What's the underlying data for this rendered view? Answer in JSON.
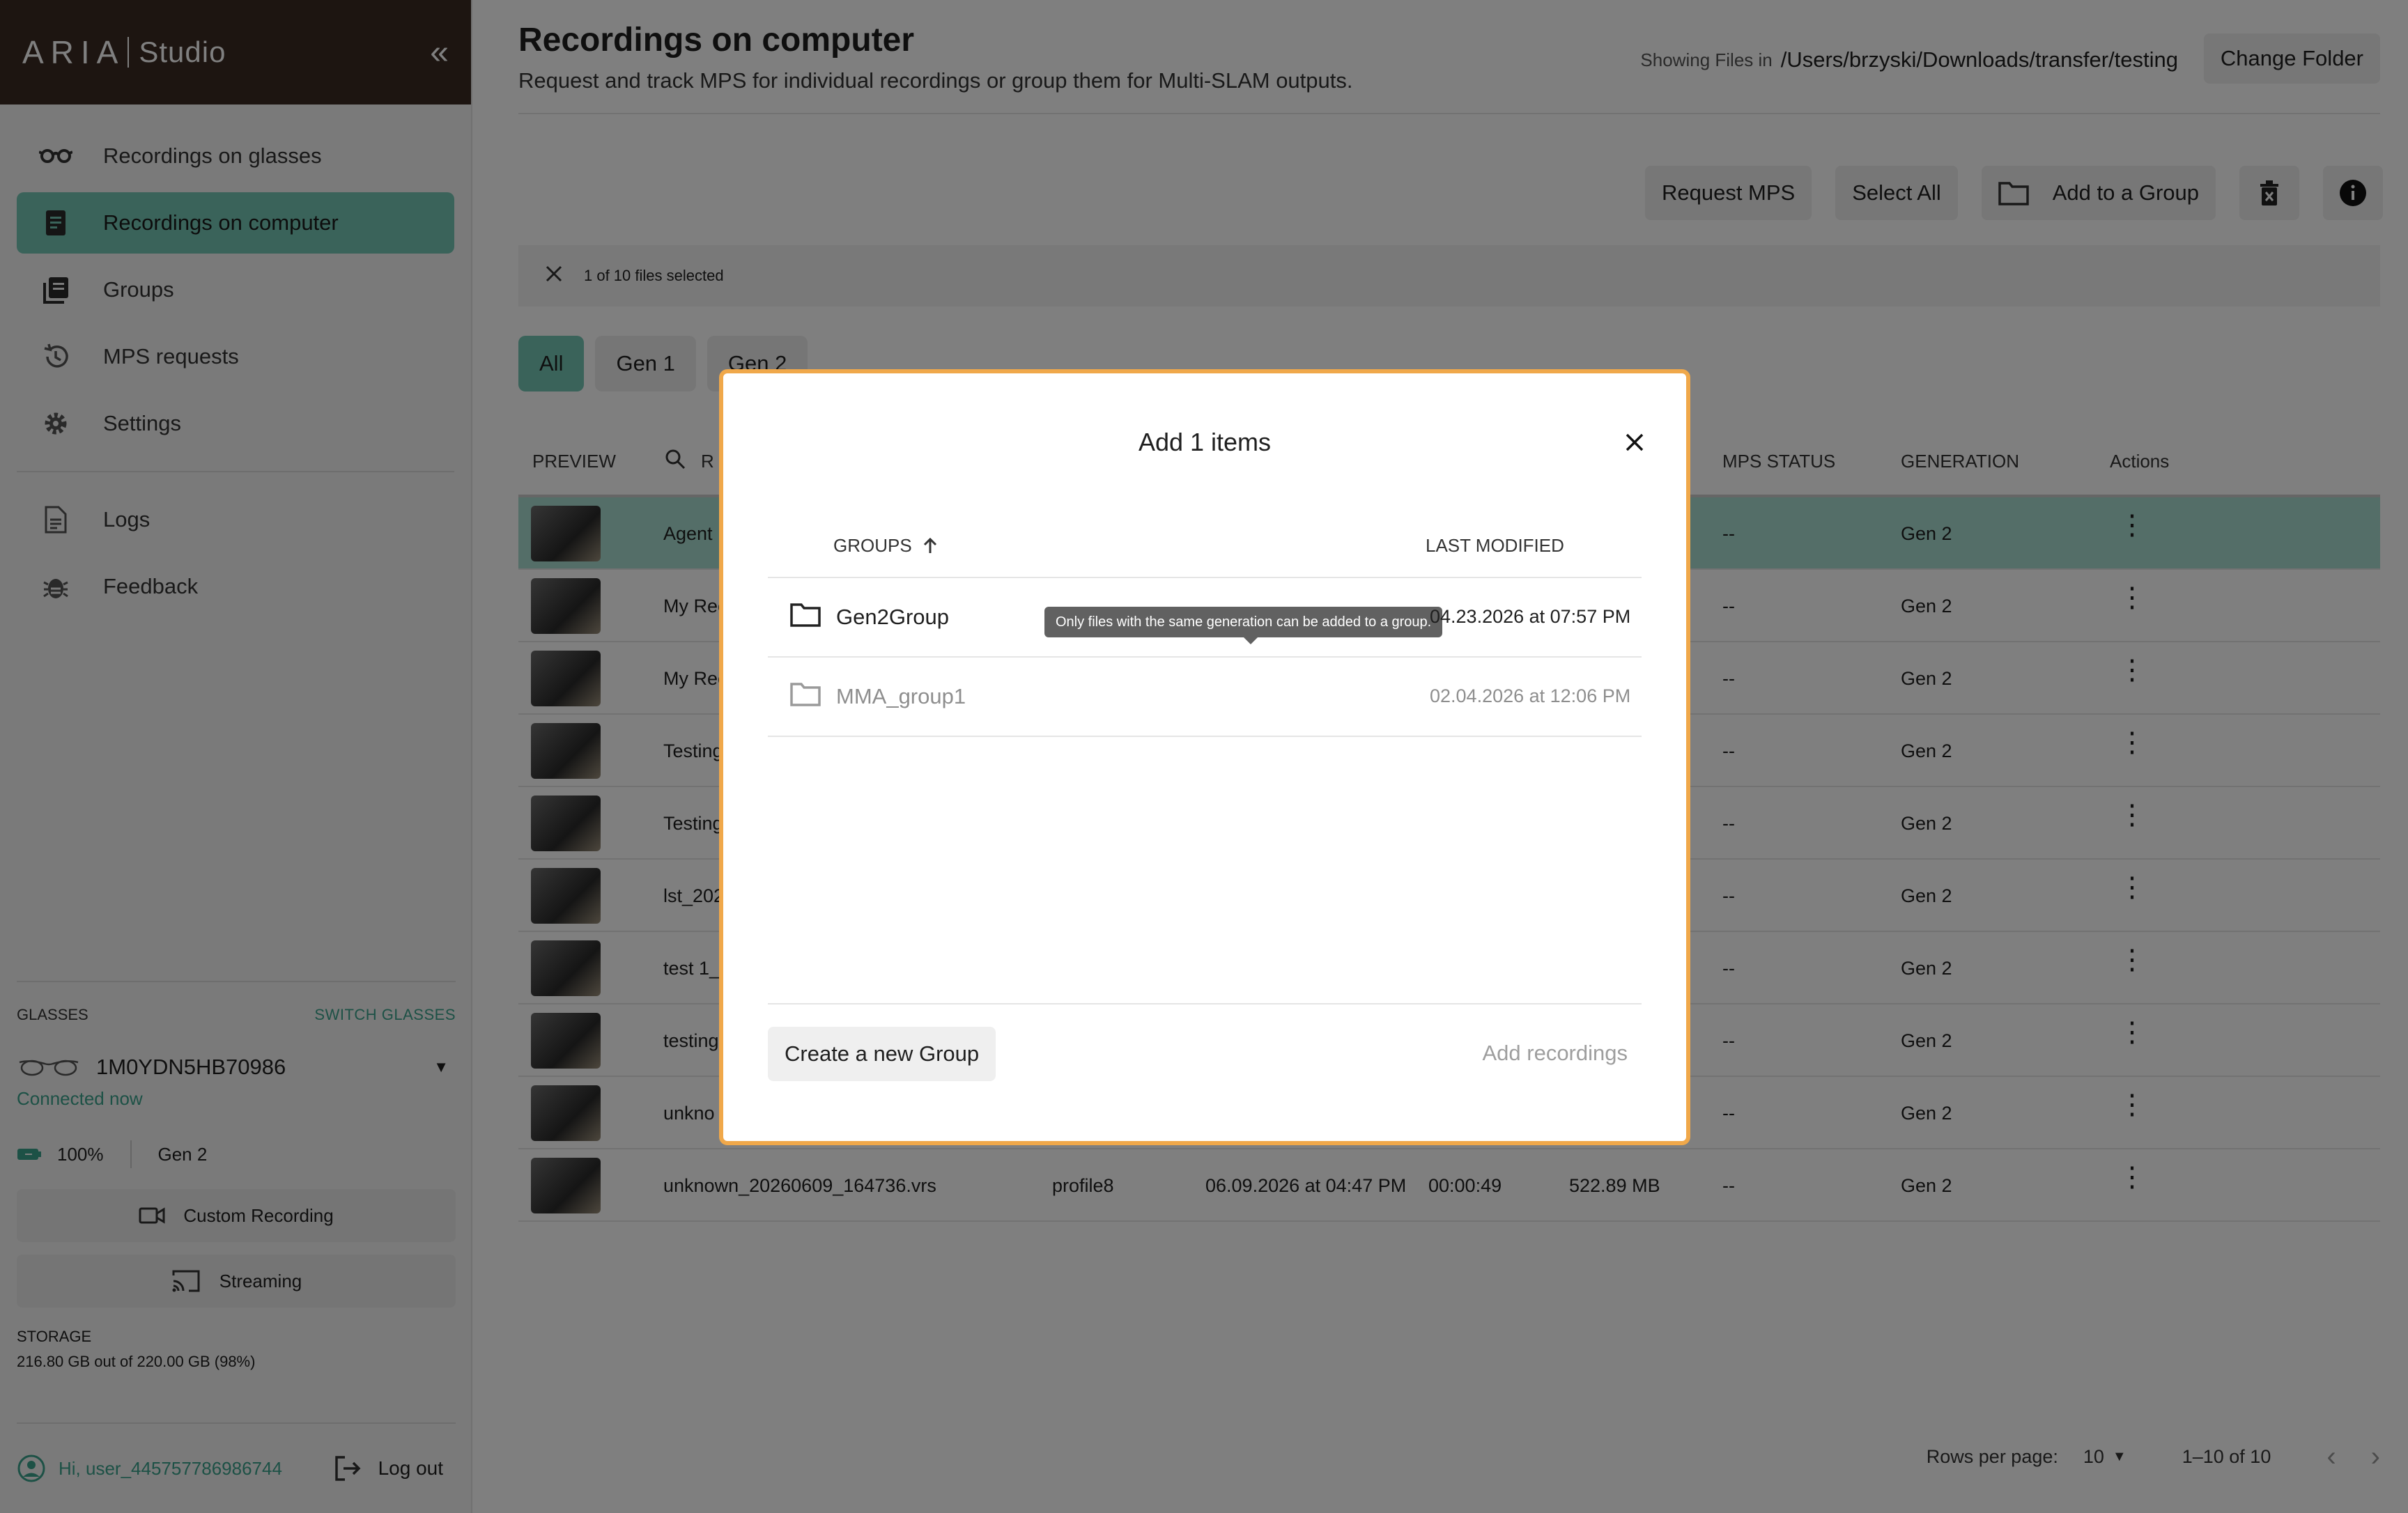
{
  "brand": {
    "name": "ARIA",
    "product": "Studio"
  },
  "sidebar": {
    "items": [
      {
        "label": "Recordings on glasses",
        "icon": "glasses-icon"
      },
      {
        "label": "Recordings on computer",
        "icon": "document-icon",
        "active": true
      },
      {
        "label": "Groups",
        "icon": "groups-icon"
      },
      {
        "label": "MPS requests",
        "icon": "history-icon"
      },
      {
        "label": "Settings",
        "icon": "gear-icon"
      }
    ],
    "secondary": [
      {
        "label": "Logs",
        "icon": "log-file-icon"
      },
      {
        "label": "Feedback",
        "icon": "bug-icon"
      }
    ],
    "glasses": {
      "section_label": "GLASSES",
      "switch_label": "SWITCH GLASSES",
      "device_name": "1M0YDN5HB70986",
      "status": "Connected now",
      "battery": "100%",
      "generation": "Gen 2",
      "custom_recording_label": "Custom Recording",
      "streaming_label": "Streaming",
      "storage_label": "STORAGE",
      "storage_value": "216.80 GB out of 220.00 GB (98%)"
    },
    "footer": {
      "user": "Hi, user_445757786986744",
      "logout_label": "Log out"
    }
  },
  "header": {
    "title": "Recordings on computer",
    "subtitle": "Request and track MPS for individual recordings or group them for Multi-SLAM outputs.",
    "folder_label": "Showing Files in",
    "folder_path": "/Users/brzyski/Downloads/transfer/testing",
    "change_folder_label": "Change Folder"
  },
  "toolbar": {
    "request_mps": "Request MPS",
    "select_all": "Select All",
    "add_to_group": "Add to a Group"
  },
  "selection": {
    "text": "1 of 10 files selected"
  },
  "filters": [
    "All",
    "Gen 1",
    "Gen 2"
  ],
  "table": {
    "headers": {
      "preview": "PREVIEW",
      "name": "R",
      "mps_status": "MPS STATUS",
      "generation": "GENERATION",
      "actions": "Actions"
    },
    "rows": [
      {
        "name": "Agent",
        "profile": "",
        "date": "",
        "duration": "",
        "size": "",
        "mps": "--",
        "gen": "Gen 2",
        "selected": true
      },
      {
        "name": "My Rec",
        "profile": "",
        "date": "",
        "duration": "",
        "size": "",
        "mps": "--",
        "gen": "Gen 2"
      },
      {
        "name": "My Rec",
        "profile": "",
        "date": "",
        "duration": "",
        "size": "",
        "mps": "--",
        "gen": "Gen 2"
      },
      {
        "name": "Testing",
        "profile": "",
        "date": "",
        "duration": "",
        "size": "",
        "mps": "--",
        "gen": "Gen 2"
      },
      {
        "name": "Testing",
        "profile": "",
        "date": "",
        "duration": "",
        "size": "",
        "mps": "--",
        "gen": "Gen 2"
      },
      {
        "name": "lst_202",
        "profile": "",
        "date": "",
        "duration": "",
        "size": "",
        "mps": "--",
        "gen": "Gen 2"
      },
      {
        "name": "test 1_",
        "profile": "",
        "date": "",
        "duration": "",
        "size": "",
        "mps": "--",
        "gen": "Gen 2"
      },
      {
        "name": "testing",
        "profile": "",
        "date": "",
        "duration": "",
        "size": "",
        "mps": "--",
        "gen": "Gen 2"
      },
      {
        "name": "unkno",
        "profile": "",
        "date": "",
        "duration": "",
        "size": "",
        "mps": "--",
        "gen": "Gen 2"
      },
      {
        "name": "unknown_20260609_164736.vrs",
        "profile": "profile8",
        "date": "06.09.2026 at 04:47 PM",
        "duration": "00:00:49",
        "size": "522.89 MB",
        "mps": "--",
        "gen": "Gen 2"
      }
    ]
  },
  "pagination": {
    "rows_label": "Rows per page:",
    "rows_value": "10",
    "range": "1–10 of 10"
  },
  "modal": {
    "title": "Add 1 items",
    "col_groups": "GROUPS",
    "col_modified": "LAST MODIFIED",
    "groups": [
      {
        "name": "Gen2Group",
        "modified": "04.23.2026 at 07:57 PM",
        "disabled": false
      },
      {
        "name": "MMA_group1",
        "modified": "02.04.2026 at 12:06 PM",
        "disabled": true
      }
    ],
    "tooltip": "Only files with the same generation can be added to a group.",
    "create_label": "Create a new Group",
    "add_label": "Add recordings"
  },
  "colors": {
    "accent": "#74c7b5",
    "accent_text": "#3aa38c",
    "brand_bg": "#3a2a22",
    "modal_border": "#f0a84a"
  }
}
